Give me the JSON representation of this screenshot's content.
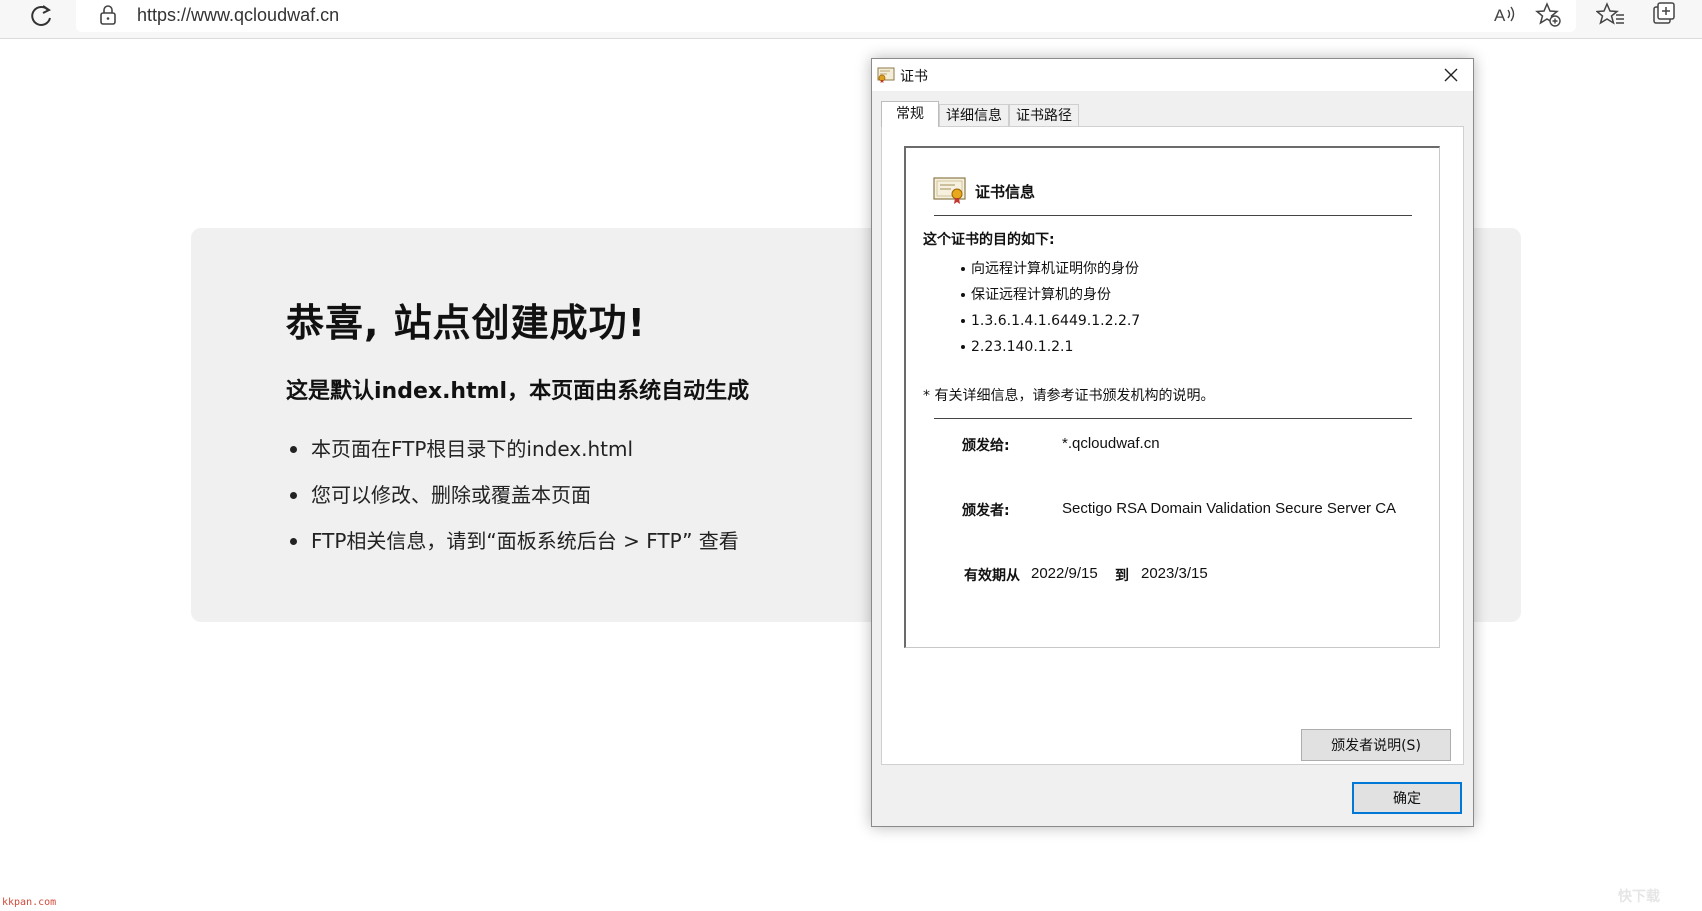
{
  "browser": {
    "url": "https://www.qcloudwaf.cn",
    "icons": [
      "reload-icon",
      "lock-icon",
      "read-aloud-icon",
      "add-favorite-icon",
      "favorites-icon",
      "collections-icon"
    ]
  },
  "page": {
    "headline": "恭喜, 站点创建成功!",
    "subheadline": "这是默认index.html，本页面由系统自动生成",
    "bullets": [
      "本页面在FTP根目录下的index.html",
      "您可以修改、删除或覆盖本页面",
      "FTP相关信息，请到“面板系统后台 > FTP” 查看"
    ],
    "panel_color": "#f0f0f0"
  },
  "dialog": {
    "title": "证书",
    "tabs": [
      {
        "label": "常规",
        "active": true
      },
      {
        "label": "详细信息",
        "active": false
      },
      {
        "label": "证书路径",
        "active": false
      }
    ],
    "info_title": "证书信息",
    "purpose_heading": "这个证书的目的如下:",
    "purposes": [
      "向远程计算机证明你的身份",
      "保证远程计算机的身份",
      "1.3.6.1.4.1.6449.1.2.2.7",
      "2.23.140.1.2.1"
    ],
    "note": "* 有关详细信息，请参考证书颁发机构的说明。",
    "issued_to_label": "颁发给:",
    "issued_to_value": "*.qcloudwaf.cn",
    "issued_by_label": "颁发者:",
    "issued_by_value": "Sectigo RSA Domain Validation Secure Server CA",
    "valid_from_label": "有效期从",
    "valid_from_value": "2022/9/15",
    "valid_to_label": "到",
    "valid_to_value": "2023/3/15",
    "issuer_statement_button": "颁发者说明(S)",
    "ok_button": "确定",
    "accent_color": "#0078d7"
  },
  "watermarks": {
    "left": "kkpan.com",
    "right": "快下载"
  }
}
